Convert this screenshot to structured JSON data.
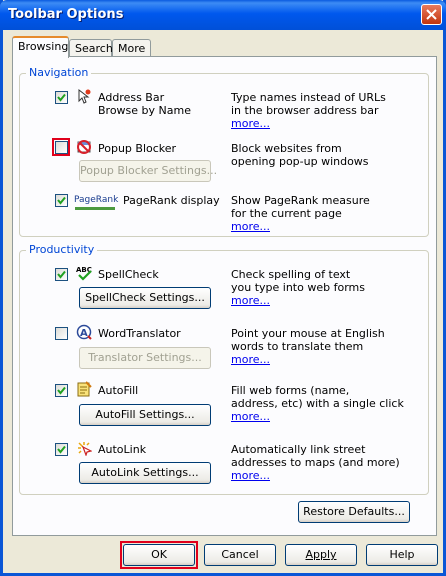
{
  "window": {
    "title": "Toolbar Options"
  },
  "tabs": [
    {
      "label": "Browsing"
    },
    {
      "label": "Search"
    },
    {
      "label": "More"
    }
  ],
  "navigation": {
    "legend": "Navigation",
    "items": [
      {
        "label_line1": "Address Bar",
        "label_line2": "Browse by Name",
        "checked": true,
        "icon": "address-bar-icon",
        "desc_line1": "Type names instead of URLs",
        "desc_line2": "in the browser address bar",
        "more": "more..."
      },
      {
        "label": "Popup Blocker",
        "checked": false,
        "icon": "popup-blocker-icon",
        "button": "Popup Blocker Settings...",
        "desc_line1": "Block websites from",
        "desc_line2": "opening pop-up windows"
      },
      {
        "logo": "PageRank",
        "label": "PageRank display",
        "checked": true,
        "desc_line1": "Show PageRank measure",
        "desc_line2": "for the current page",
        "more": "more..."
      }
    ]
  },
  "productivity": {
    "legend": "Productivity",
    "items": [
      {
        "label": "SpellCheck",
        "checked": true,
        "icon": "spellcheck-icon",
        "button": "SpellCheck Settings...",
        "desc_line1": "Check spelling of text",
        "desc_line2": "you type into web forms",
        "more": "more..."
      },
      {
        "label": "WordTranslator",
        "checked": false,
        "icon": "word-translator-icon",
        "button": "Translator Settings...",
        "desc_line1": "Point your mouse at English",
        "desc_line2": "words to translate them",
        "more": "more..."
      },
      {
        "label": "AutoFill",
        "checked": true,
        "icon": "autofill-icon",
        "button": "AutoFill Settings...",
        "desc_line1": "Fill web forms (name,",
        "desc_line2": "address, etc) with a single click",
        "more": "more..."
      },
      {
        "label": "AutoLink",
        "checked": true,
        "icon": "autolink-icon",
        "button": "AutoLink Settings...",
        "desc_line1": "Automatically link street",
        "desc_line2": "addresses to maps (and more)",
        "more": "more..."
      }
    ]
  },
  "restore_defaults": "Restore Defaults...",
  "footer": {
    "ok": "OK",
    "cancel": "Cancel",
    "apply": "Apply",
    "help": "Help"
  },
  "colors": {
    "highlight": "#e0001b",
    "link": "#0000ee",
    "legend": "#0046d5",
    "title_bar": "#0058ee"
  }
}
